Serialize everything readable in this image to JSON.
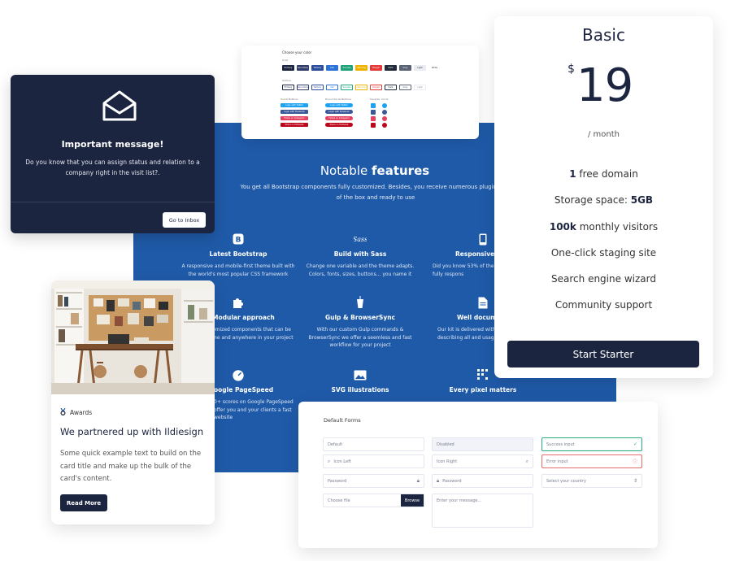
{
  "buttons_card": {
    "heading": "Choose your color",
    "label_solid": "Solid",
    "label_outline": "Outline",
    "label_social": "Social Buttons",
    "label_round_social": "Round Social Buttons",
    "label_squares": "Squares",
    "label_circle": "Circle",
    "solid": [
      {
        "label": "Primary",
        "color": "#1c2540"
      },
      {
        "label": "Secondary",
        "color": "#303d6b"
      },
      {
        "label": "Tertiary",
        "color": "#2a4e9c"
      },
      {
        "label": "Info",
        "color": "#2d72d6"
      },
      {
        "label": "Success",
        "color": "#1fa37a"
      },
      {
        "label": "Warning",
        "color": "#f0b400"
      },
      {
        "label": "Danger",
        "color": "#e53a3a"
      },
      {
        "label": "Dark",
        "color": "#232a3a"
      },
      {
        "label": "Gray",
        "color": "#5a6275"
      },
      {
        "label": "Light",
        "color": "#e9ecf2"
      },
      {
        "label": "White",
        "color": "#ffffff"
      }
    ],
    "social": [
      {
        "label": "Login with Twitter",
        "color": "#1da1f2"
      },
      {
        "label": "Login with Facebook",
        "color": "#3b5998"
      },
      {
        "label": "Follow on Instagram",
        "color": "#e4405f"
      },
      {
        "label": "Share on Pinterest",
        "color": "#bd081c"
      }
    ]
  },
  "features": {
    "title_plain": "Notable ",
    "title_bold": "features",
    "lead": "You get all Bootstrap components fully customized. Besides, you receive numerous plugins out of the box and ready to use",
    "items": [
      {
        "icon": "bootstrap-icon",
        "title": "Latest Bootstrap",
        "text": "A responsive and mobile-first theme built with the world's most popular CSS framework"
      },
      {
        "icon": "sass-icon",
        "title": "Build with Sass",
        "text": "Change one variable and the theme adapts. Colors, fonts, sizes, buttons... you name it"
      },
      {
        "icon": "mobile-icon",
        "title": "Responsive D",
        "text": "Did you know 53% of the w mobile? Pixel is fully respons"
      },
      {
        "icon": "puzzle-icon",
        "title": "Modular approach",
        "text": "omized components that can be me and anywhere in your project"
      },
      {
        "icon": "cup-icon",
        "title": "Gulp & BrowserSync",
        "text": "With our custom Gulp commands & BrowserSync we offer a seemless and fast workflow for your project"
      },
      {
        "icon": "document-icon",
        "title": "Well docume",
        "text": "Our kit is delivered with documentation, describing all and usage"
      },
      {
        "icon": "speedometer-icon",
        "title": "oogle PageSpeed",
        "text": "0+ scores on Google PageSpeed offer you and your clients a fast website"
      },
      {
        "icon": "image-icon",
        "title": "SVG illustrations",
        "text": ""
      },
      {
        "icon": "pixels-icon",
        "title": "Every pixel matters",
        "text": ""
      }
    ]
  },
  "message": {
    "title": "Important message!",
    "text": "Do you know that you can assign status and relation to a company right in the visit list?.",
    "button": "Go to Inbox"
  },
  "pricing": {
    "plan": "Basic",
    "currency": "$",
    "amount": "19",
    "period": "/ month",
    "features": [
      {
        "bold": "1",
        "text": " free domain"
      },
      {
        "bold": "",
        "text": "Storage space: ",
        "bold_after": "5GB"
      },
      {
        "bold": "100k",
        "text": " monthly visitors"
      },
      {
        "bold": "",
        "text": "One-click staging site"
      },
      {
        "bold": "",
        "text": "Search engine wizard"
      },
      {
        "bold": "",
        "text": "Community support"
      }
    ],
    "cta": "Start Starter"
  },
  "blog": {
    "badge": "Awards",
    "title": "We partnered up with Ildiesign",
    "text": "Some quick example text to build on the card title and make up the bulk of the card's content.",
    "button": "Read More"
  },
  "forms": {
    "title": "Default Forms",
    "default": "Default",
    "disabled": "Disabled",
    "success": "Success input",
    "icon_left": "Icon Left",
    "icon_right": "Icon Right",
    "error": "Error input",
    "password": "Password",
    "password2": "Password",
    "country": "Select your country",
    "choose_file": "Choose file",
    "browse": "Browse",
    "message": "Enter your message..."
  },
  "colors": {
    "navy": "#1c2540",
    "feature_blue": "#1f5aa8",
    "success": "#2aa876",
    "error": "#e26d6d"
  }
}
